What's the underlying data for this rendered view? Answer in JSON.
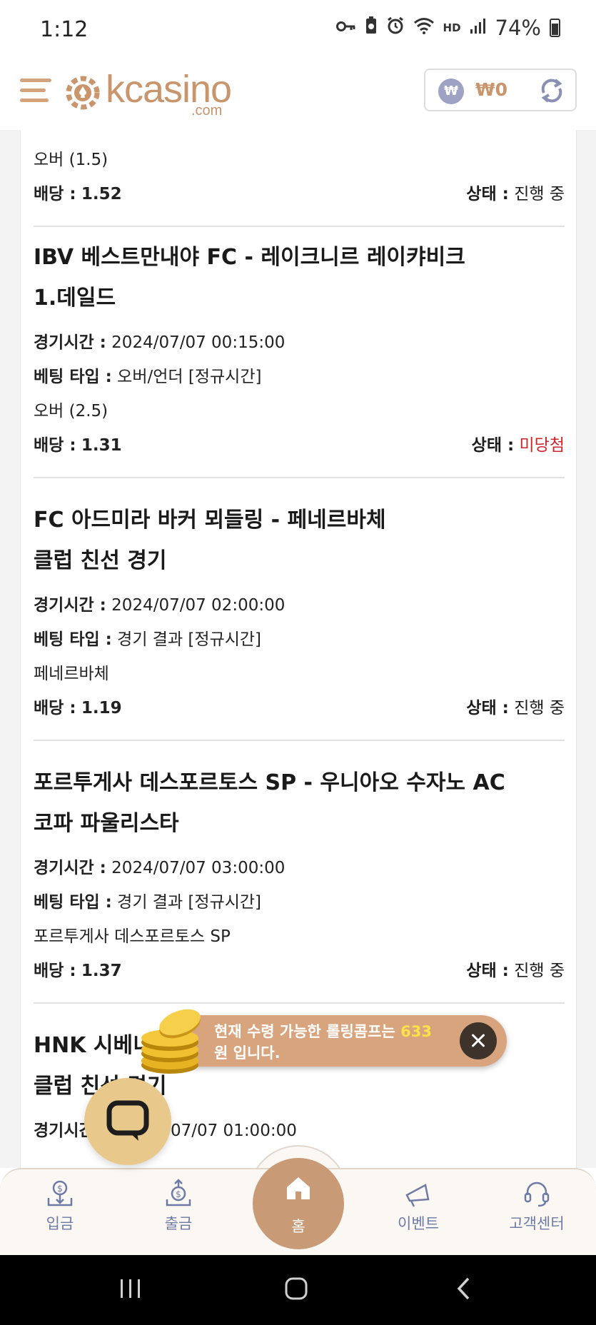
{
  "status_bar": {
    "time": "1:12",
    "hd": "HD",
    "battery": "74%"
  },
  "header": {
    "logo_text": "kcasino",
    "logo_sub": ".com",
    "balance": "₩0",
    "coin_symbol": "₩"
  },
  "bets": [
    {
      "selection": "오버 (1.5)",
      "odds_label": "배당 :",
      "odds": "1.52",
      "status_label": "상태 :",
      "status": "진행 중"
    },
    {
      "title_line1": "IBV 베스트만내야 FC - 레이크니르 레이캬비크",
      "title_line2": "1.데일드",
      "time_label": "경기시간 :",
      "time": "2024/07/07 00:15:00",
      "type_label": "베팅 타입 :",
      "type": "오버/언더 [정규시간]",
      "selection": "오버 (2.5)",
      "odds_label": "배당 :",
      "odds": "1.31",
      "status_label": "상태 :",
      "status": "미당첨"
    },
    {
      "title_line1": "FC 아드미라 바커 뫼들링 - 페네르바체",
      "title_line2": "클럽 친선 경기",
      "time_label": "경기시간 :",
      "time": "2024/07/07 02:00:00",
      "type_label": "베팅 타입 :",
      "type": "경기 결과 [정규시간]",
      "selection": "페네르바체",
      "odds_label": "배당 :",
      "odds": "1.19",
      "status_label": "상태 :",
      "status": "진행 중"
    },
    {
      "title_line1": "포르투게사 데스포르토스 SP - 우니아오 수자노 AC",
      "title_line2": "코파 파울리스타",
      "time_label": "경기시간 :",
      "time": "2024/07/07 03:00:00",
      "type_label": "베팅 타입 :",
      "type": "경기 결과 [정규시간]",
      "selection": "포르투게사 데스포르토스 SP",
      "odds_label": "배당 :",
      "odds": "1.37",
      "status_label": "상태 :",
      "status": "진행 중"
    },
    {
      "title_line1": "HNK 시베니",
      "title_line2": "클럽 친선 경기",
      "time_label": "경기시간",
      "time": "07/07 01:00:00"
    }
  ],
  "toast": {
    "text_before": "현재 수령 가능한 롤링콤프는 ",
    "amount": "633",
    "text_after": " 원 입니다."
  },
  "bottom_nav": {
    "deposit": "입금",
    "withdraw": "출금",
    "home": "홈",
    "events": "이벤트",
    "support": "고객센터"
  },
  "colors": {
    "accent": "#c8956c",
    "status_lost": "#d0262b",
    "nav_text": "#6d7aa6",
    "toast_bg": "#d8a47e",
    "toast_highlight": "#ffe14a"
  }
}
